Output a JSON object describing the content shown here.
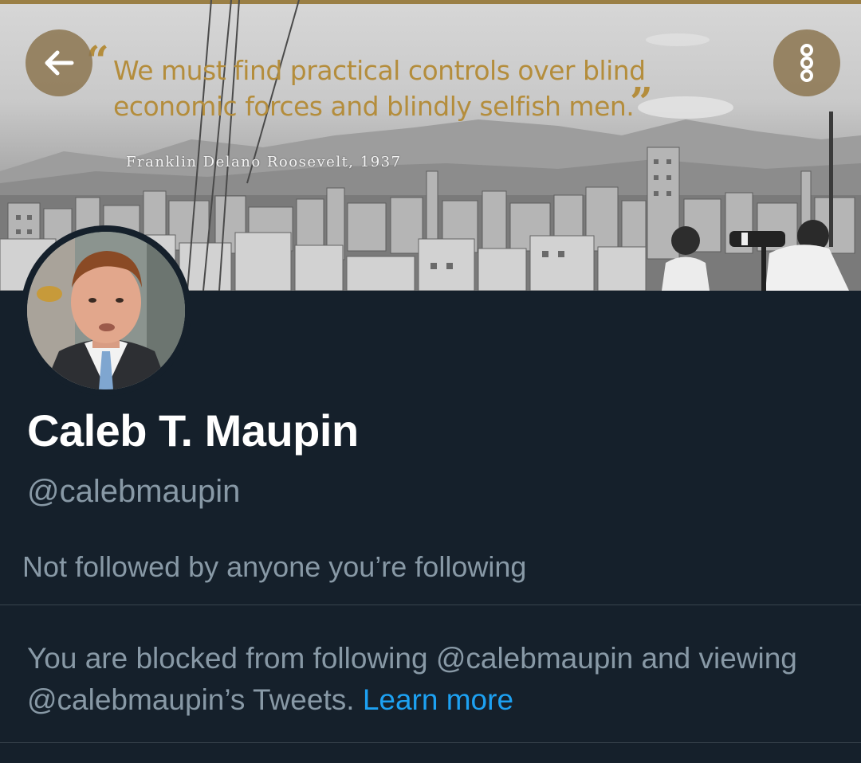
{
  "header": {
    "back_icon": "arrow-left-icon",
    "more_icon": "more-vertical-icon"
  },
  "banner": {
    "quote_line1": "We must find practical controls over blind",
    "quote_line2": "economic forces and blindly selfish men.",
    "quote_open_mark": "“",
    "quote_close_mark": "”",
    "attribution": "Franklin Delano Roosevelt, 1937",
    "accent_color": "#b48d3c"
  },
  "profile": {
    "name": "Caleb T. Maupin",
    "handle": "@calebmaupin",
    "followers_note": "Not followed by anyone you’re following"
  },
  "blocked": {
    "message_prefix": "You are blocked from following @calebmaupin and viewing @calebmaupin’s Tweets.",
    "learn_more": "Learn more",
    "link_color": "#1da1f2"
  },
  "theme": {
    "background": "#15202b",
    "secondary_text": "#8899a6",
    "divider": "#38444d"
  }
}
